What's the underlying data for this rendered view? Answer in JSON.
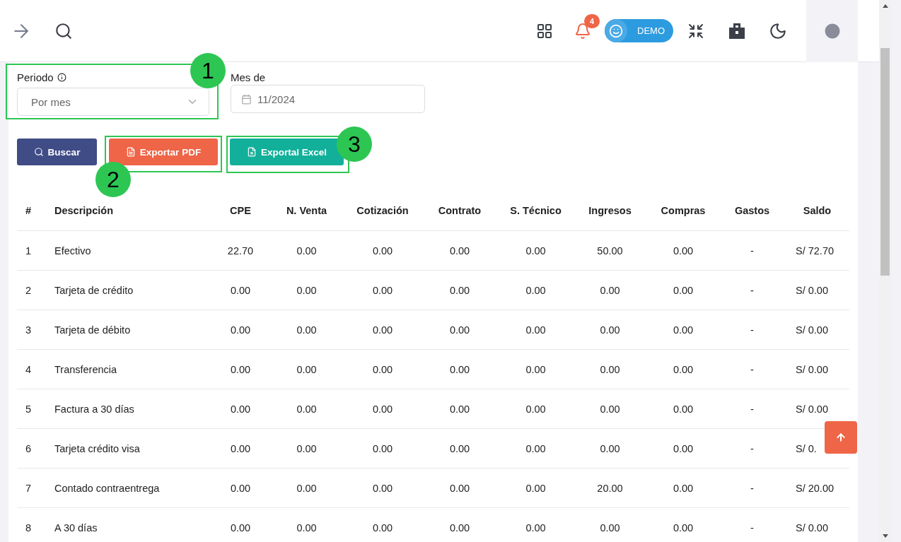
{
  "topbar": {
    "notification_count": "4",
    "demo_label": "DEMO"
  },
  "filters": {
    "period_label": "Periodo",
    "period_value": "Por mes",
    "month_label": "Mes de",
    "month_value": "11/2024"
  },
  "buttons": [
    {
      "kind": "search",
      "label": "Buscar"
    },
    {
      "kind": "pdf",
      "label": "Exportar PDF"
    },
    {
      "kind": "excel",
      "label": "Exportal Excel"
    }
  ],
  "callouts": [
    {
      "kind": "period",
      "label": "1"
    },
    {
      "kind": "pdf",
      "label": "2"
    },
    {
      "kind": "excel",
      "label": "3"
    }
  ],
  "table": {
    "columns": [
      "#",
      "Descripción",
      "CPE",
      "N. Venta",
      "Cotización",
      "Contrato",
      "S. Técnico",
      "Ingresos",
      "Compras",
      "Gastos",
      "Saldo"
    ],
    "rows": [
      [
        "1",
        "Efectivo",
        "22.70",
        "0.00",
        "0.00",
        "0.00",
        "0.00",
        "50.00",
        "0.00",
        "-",
        "S/ 72.70"
      ],
      [
        "2",
        "Tarjeta de crédito",
        "0.00",
        "0.00",
        "0.00",
        "0.00",
        "0.00",
        "0.00",
        "0.00",
        "-",
        "S/ 0.00"
      ],
      [
        "3",
        "Tarjeta de débito",
        "0.00",
        "0.00",
        "0.00",
        "0.00",
        "0.00",
        "0.00",
        "0.00",
        "-",
        "S/ 0.00"
      ],
      [
        "4",
        "Transferencia",
        "0.00",
        "0.00",
        "0.00",
        "0.00",
        "0.00",
        "0.00",
        "0.00",
        "-",
        "S/ 0.00"
      ],
      [
        "5",
        "Factura a 30 días",
        "0.00",
        "0.00",
        "0.00",
        "0.00",
        "0.00",
        "0.00",
        "0.00",
        "-",
        "S/ 0.00"
      ],
      [
        "6",
        "Tarjeta crédito visa",
        "0.00",
        "0.00",
        "0.00",
        "0.00",
        "0.00",
        "0.00",
        "0.00",
        "-",
        "S/ 0."
      ],
      [
        "7",
        "Contado contraentrega",
        "0.00",
        "0.00",
        "0.00",
        "0.00",
        "0.00",
        "20.00",
        "0.00",
        "-",
        "S/ 20.00"
      ],
      [
        "8",
        "A 30 días",
        "0.00",
        "0.00",
        "0.00",
        "0.00",
        "0.00",
        "0.00",
        "0.00",
        "-",
        "S/ 0.00"
      ]
    ]
  }
}
